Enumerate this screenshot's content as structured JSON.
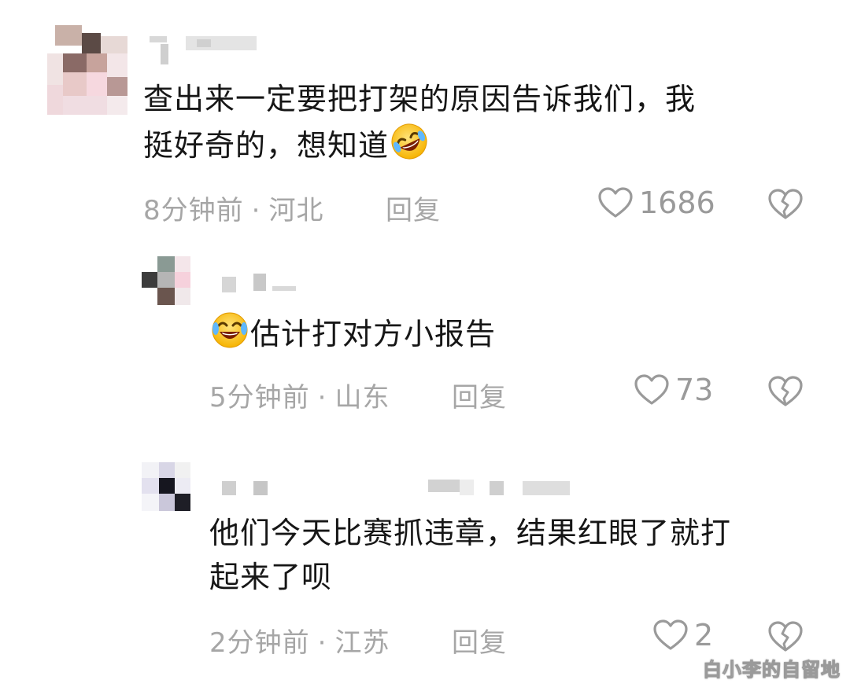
{
  "comments": [
    {
      "text_lines": [
        "查出来一定要把打架的原因告诉我们，我",
        "挺好奇的，想知道"
      ],
      "time": "8分钟前",
      "location": "河北",
      "reply_label": "回复",
      "likes": "1686"
    },
    {
      "text": "估计打对方小报告",
      "time": "5分钟前",
      "location": "山东",
      "reply_label": "回复",
      "likes": "73"
    },
    {
      "text_lines": [
        "他们今天比赛抓违章，结果红眼了就打",
        "起来了呗"
      ],
      "time": "2分钟前",
      "location": "江苏",
      "reply_label": "回复",
      "likes": "2"
    }
  ],
  "separator": "·",
  "watermark": "白小李的自留地",
  "icons": {
    "like": "heart-outline-icon",
    "dislike": "broken-heart-icon",
    "emoji_1": "rolling-laughing-emoji",
    "emoji_2": "crying-laughing-emoji"
  }
}
